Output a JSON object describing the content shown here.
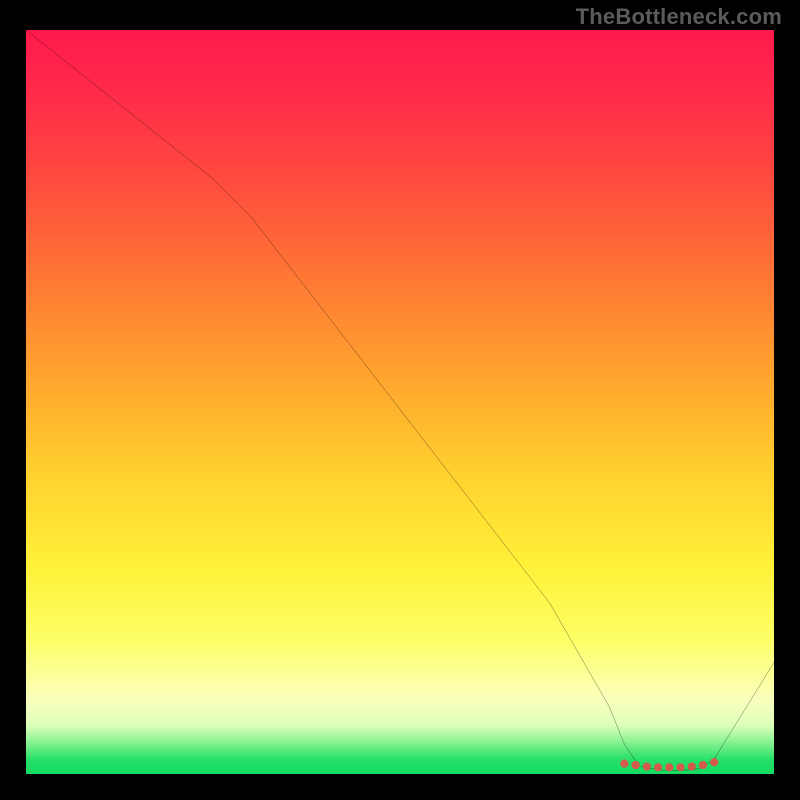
{
  "watermark": "TheBottleneck.com",
  "chart_data": {
    "type": "line",
    "title": "",
    "xlabel": "",
    "ylabel": "",
    "xlim": [
      0,
      100
    ],
    "ylim": [
      0,
      100
    ],
    "grid": false,
    "legend": false,
    "series": [
      {
        "name": "curve",
        "x": [
          0,
          10,
          20,
          25,
          30,
          40,
          50,
          60,
          70,
          78,
          80,
          82,
          85,
          88,
          90,
          92,
          100
        ],
        "y": [
          100,
          92,
          84,
          80,
          75,
          62,
          49,
          36,
          23,
          9,
          4,
          1,
          0.5,
          0.5,
          0.7,
          2,
          15
        ]
      }
    ],
    "markers": {
      "name": "valley-dots",
      "color": "#d45a4a",
      "x": [
        80,
        81.5,
        83,
        84.5,
        86,
        87.5,
        89,
        90.5,
        92
      ],
      "y": [
        1.4,
        1.2,
        1.0,
        0.9,
        0.9,
        0.9,
        1.0,
        1.2,
        1.6
      ]
    },
    "gradient_stops": [
      {
        "pos": 0,
        "color": "#ff1a4d"
      },
      {
        "pos": 20,
        "color": "#ff4a3e"
      },
      {
        "pos": 48,
        "color": "#ffa92e"
      },
      {
        "pos": 72,
        "color": "#fff138"
      },
      {
        "pos": 90,
        "color": "#fbffbd"
      },
      {
        "pos": 100,
        "color": "#12db63"
      }
    ]
  }
}
